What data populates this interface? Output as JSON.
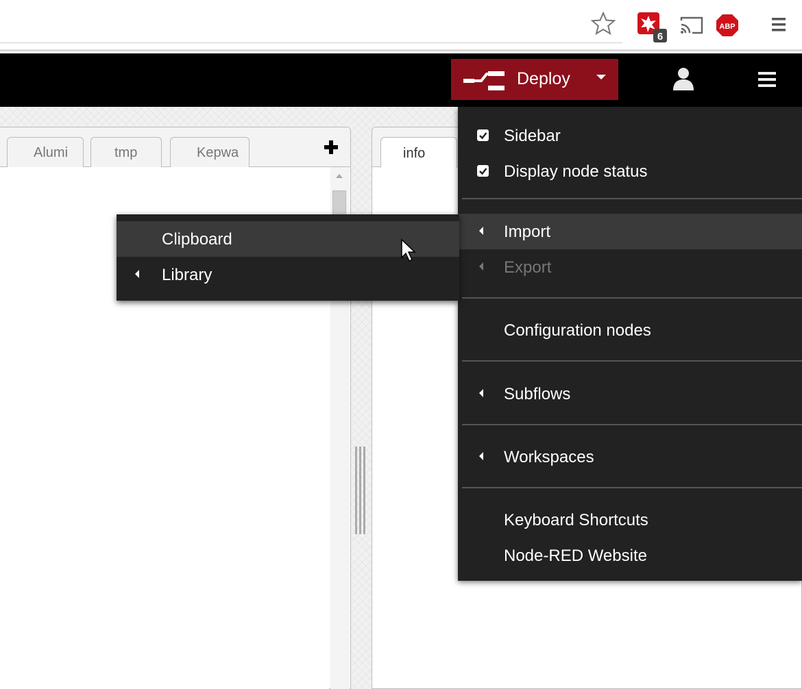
{
  "browser": {
    "icons": [
      "star-icon",
      "extension-icon",
      "cast-icon",
      "adblock-icon",
      "chrome-menu-icon"
    ],
    "extension_badge": "6",
    "abp_label": "ABP"
  },
  "header": {
    "deploy_label": "Deploy",
    "icons": [
      "deploy-icon",
      "caret-down-icon",
      "user-icon",
      "hamburger-menu-icon"
    ],
    "colors": {
      "header_bg": "#000000",
      "deploy_bg": "#8c101c"
    }
  },
  "workspace": {
    "tabs": [
      {
        "label": "Alumi"
      },
      {
        "label": "tmp"
      },
      {
        "label": "Kepwa"
      }
    ],
    "add_tab_icon": "plus-icon"
  },
  "sidebar": {
    "tabs": [
      {
        "label": "info"
      }
    ]
  },
  "main_menu": {
    "sidebar": {
      "label": "Sidebar",
      "checked": true
    },
    "display_node_status": {
      "label": "Display node status",
      "checked": true
    },
    "import": {
      "label": "Import"
    },
    "export": {
      "label": "Export",
      "disabled": true
    },
    "configuration_nodes": {
      "label": "Configuration nodes"
    },
    "subflows": {
      "label": "Subflows"
    },
    "workspaces": {
      "label": "Workspaces"
    },
    "keyboard_shortcuts": {
      "label": "Keyboard Shortcuts"
    },
    "website": {
      "label": "Node-RED Website"
    },
    "colors": {
      "menu_bg": "#222222",
      "highlight_bg": "#3a3a3a",
      "disabled_text": "#777777"
    }
  },
  "import_submenu": {
    "clipboard": {
      "label": "Clipboard"
    },
    "library": {
      "label": "Library"
    }
  }
}
